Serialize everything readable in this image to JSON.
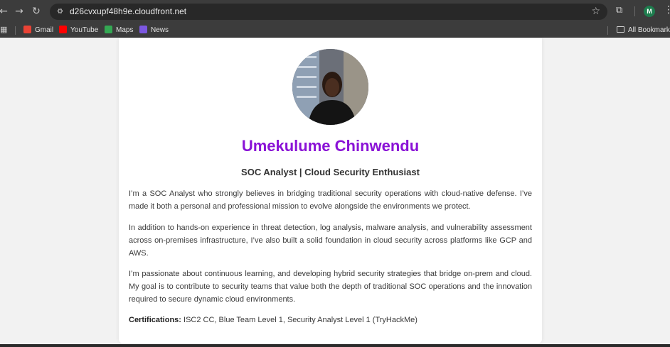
{
  "browser": {
    "url": "d26cvxupf48h9e.cloudfront.net",
    "profile_initial": "M",
    "bookmarks": [
      {
        "label": "Gmail",
        "color": "#ea4335"
      },
      {
        "label": "YouTube",
        "color": "#ff0000"
      },
      {
        "label": "Maps",
        "color": "#34a853"
      },
      {
        "label": "News",
        "color": "#7b57e0"
      }
    ],
    "all_bookmarks_label": "All Bookmarks"
  },
  "profile": {
    "name": "Umekulume Chinwendu",
    "title": "SOC Analyst | Cloud Security Enthusiast",
    "paragraphs": [
      "I’m a SOC Analyst who strongly believes in bridging traditional security operations with cloud-native defense. I’ve made it both a personal and professional mission to evolve alongside the environments we protect.",
      "In addition to hands-on experience in threat detection, log analysis, malware analysis, and vulnerability assessment across on-premises infrastructure, I’ve also built a solid foundation in cloud security across platforms like GCP and AWS.",
      "I’m passionate about continuous learning, and developing hybrid security strategies that bridge on-prem and cloud. My goal is to contribute to security teams that value both the depth of traditional SOC operations and the innovation required to secure dynamic cloud environments."
    ],
    "certifications_label": "Certifications:",
    "certifications": "ISC2 CC, Blue Team Level 1, Security Analyst Level 1 (TryHackMe)"
  },
  "colors": {
    "name_accent": "#8a12d6",
    "chrome_bg": "#3c3c3c"
  }
}
